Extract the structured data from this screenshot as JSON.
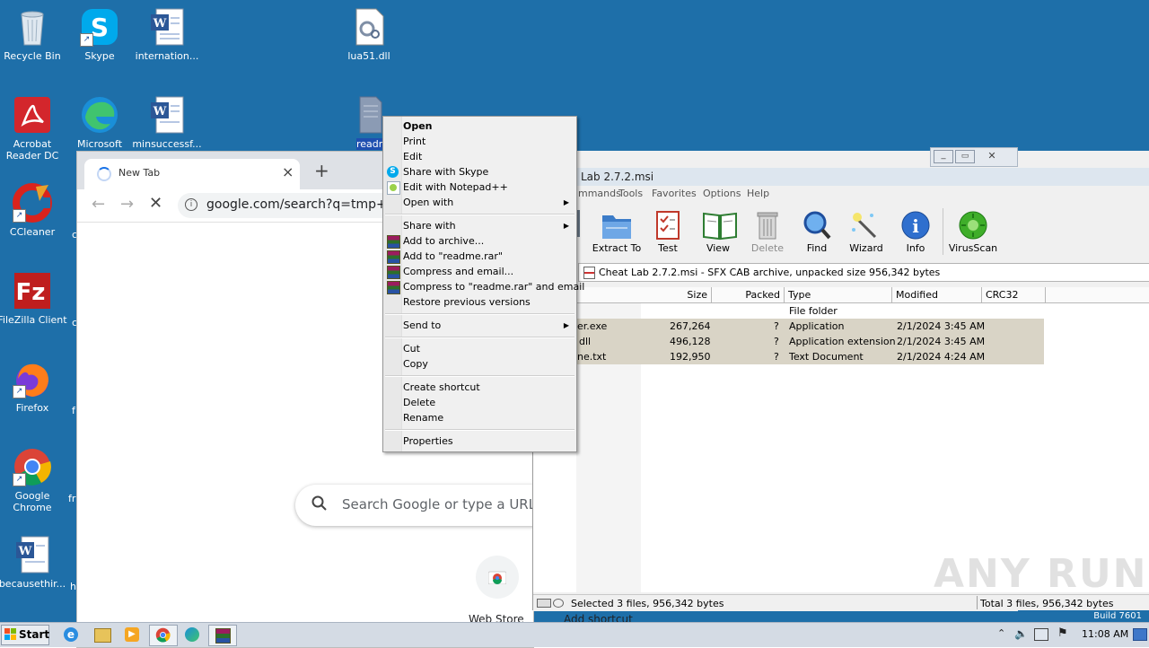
{
  "desktop": {
    "background": "#1e6fa9",
    "icons": [
      {
        "label": "Recycle Bin",
        "name": "recycle-bin-icon"
      },
      {
        "label": "Skype",
        "name": "skype-icon"
      },
      {
        "label": "internation...",
        "name": "word-document-icon"
      },
      {
        "label": "lua51.dll",
        "name": "dll-file-icon"
      },
      {
        "label": "Acrobat Reader DC",
        "name": "acrobat-reader-icon"
      },
      {
        "label": "Microsoft Edge",
        "name": "edge-icon"
      },
      {
        "label": "minsuccessf...",
        "name": "word-document-icon"
      },
      {
        "label": "readme.",
        "name": "text-file-icon"
      },
      {
        "label": "CCleaner",
        "name": "ccleaner-icon"
      },
      {
        "label": "FileZilla Client",
        "name": "filezilla-icon"
      },
      {
        "label": "Firefox",
        "name": "firefox-icon"
      },
      {
        "label": "Google Chrome",
        "name": "chrome-icon"
      },
      {
        "label": "becausethir...",
        "name": "word-document-icon"
      }
    ],
    "partial_labels": [
      "c",
      "c",
      "f",
      "fr",
      "h"
    ]
  },
  "chrome": {
    "tab_title": "New Tab",
    "url": "google.com/search?q=tmp+file-",
    "search_placeholder": "Search Google or type a URL",
    "shortcut_label": "Web Store",
    "add_shortcut_label": "Add shortcut"
  },
  "context_menu": {
    "items": [
      {
        "label": "Open",
        "bold": true
      },
      {
        "label": "Print"
      },
      {
        "label": "Edit"
      },
      {
        "label": "Share with Skype",
        "icon": "skype-icon"
      },
      {
        "label": "Edit with Notepad++",
        "icon": "notepad-plus-plus-icon"
      },
      {
        "label": "Open with",
        "submenu": true
      },
      {
        "label": "Share with",
        "submenu": true
      },
      {
        "label": "Add to archive...",
        "icon": "winrar-icon"
      },
      {
        "label": "Add to \"readme.rar\"",
        "icon": "winrar-icon"
      },
      {
        "label": "Compress and email...",
        "icon": "winrar-icon"
      },
      {
        "label": "Compress to \"readme.rar\" and email",
        "icon": "winrar-icon"
      },
      {
        "label": "Restore previous versions"
      },
      {
        "label": "Send to",
        "submenu": true
      },
      {
        "label": "Cut"
      },
      {
        "label": "Copy"
      },
      {
        "label": "Create shortcut"
      },
      {
        "label": "Delete"
      },
      {
        "label": "Rename"
      },
      {
        "label": "Properties"
      }
    ]
  },
  "winrar": {
    "title": "Lab 2.7.2.msi",
    "menu": [
      "mmands",
      "Tools",
      "Favorites",
      "Options",
      "Help"
    ],
    "toolbar": [
      "Extract To",
      "Test",
      "View",
      "Delete",
      "Find",
      "Wizard",
      "Info",
      "VirusScan"
    ],
    "path": "Cheat Lab 2.7.2.msi - SFX CAB archive, unpacked size 956,342 bytes",
    "columns": [
      "Size",
      "Packed",
      "Type",
      "Modified",
      "CRC32"
    ],
    "rows": [
      {
        "name": "",
        "size": "",
        "packed": "",
        "type": "File folder",
        "modified": ""
      },
      {
        "name": "er.exe",
        "size": "267,264",
        "packed": "?",
        "type": "Application",
        "modified": "2/1/2024 3:45 AM"
      },
      {
        "name": "dll",
        "size": "496,128",
        "packed": "?",
        "type": "Application extension",
        "modified": "2/1/2024 3:45 AM"
      },
      {
        "name": "ne.txt",
        "size": "192,950",
        "packed": "?",
        "type": "Text Document",
        "modified": "2/1/2024 4:24 AM"
      }
    ],
    "status_left": "Selected 3 files, 956,342 bytes",
    "status_right": "Total 3 files, 956,342 bytes"
  },
  "taskbar": {
    "start_label": "Start",
    "time": "11:08 AM",
    "build_text": "Build 7601"
  },
  "watermark": "ANY RUN"
}
